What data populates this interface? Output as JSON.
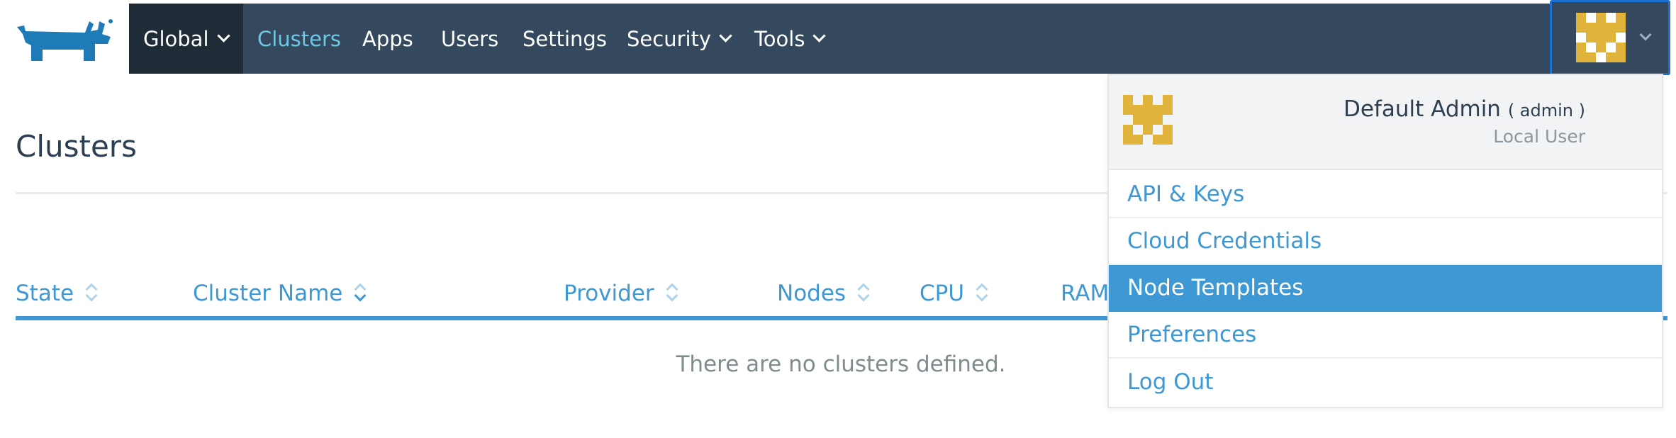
{
  "nav": {
    "global_label": "Global",
    "items": [
      {
        "label": "Clusters",
        "active": true
      },
      {
        "label": "Apps"
      },
      {
        "label": "Users"
      },
      {
        "label": "Settings"
      },
      {
        "label": "Security"
      },
      {
        "label": "Tools"
      }
    ]
  },
  "page": {
    "title": "Clusters"
  },
  "table": {
    "columns": [
      "State",
      "Cluster Name",
      "Provider",
      "Nodes",
      "CPU",
      "RAM"
    ],
    "sorted_column": "Cluster Name",
    "empty_message": "There are no clusters defined."
  },
  "user_menu": {
    "name": "Default Admin",
    "login": "( admin )",
    "type": "Local User",
    "items": [
      "API & Keys",
      "Cloud Credentials",
      "Node Templates",
      "Preferences",
      "Log Out"
    ],
    "highlighted_item": "Node Templates"
  },
  "colors": {
    "nav_bg": "#34495e",
    "nav_active": "#6fc7e6",
    "accent": "#3d98d3",
    "avatar": "#e0b33a",
    "logo": "#1e7bb8"
  },
  "icons": {
    "logo": "rancher-logo",
    "avatar": "identicon-avatar",
    "dropdown": "chevron-down-icon",
    "sort": "sort-icon"
  }
}
